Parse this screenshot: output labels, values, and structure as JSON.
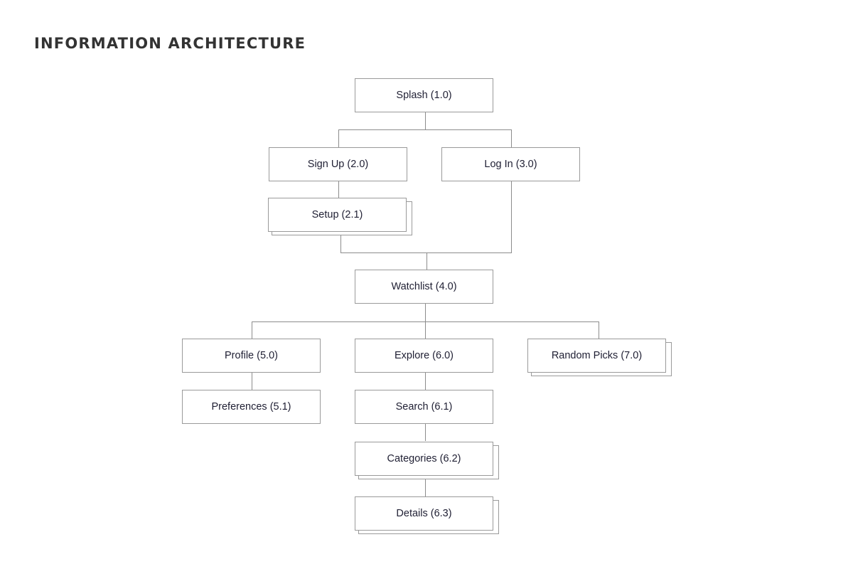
{
  "title": "INFORMATION ARCHITECTURE",
  "nodes": {
    "splash": "Splash (1.0)",
    "signup": "Sign Up (2.0)",
    "setup": "Setup (2.1)",
    "login": "Log In (3.0)",
    "watchlist": "Watchlist (4.0)",
    "profile": "Profile (5.0)",
    "preferences": "Preferences (5.1)",
    "explore": "Explore (6.0)",
    "search": "Search (6.1)",
    "categories": "Categories (6.2)",
    "details": "Details (6.3)",
    "random_picks": "Random Picks (7.0)"
  },
  "stacked_nodes": [
    "setup",
    "random_picks",
    "categories",
    "details"
  ]
}
